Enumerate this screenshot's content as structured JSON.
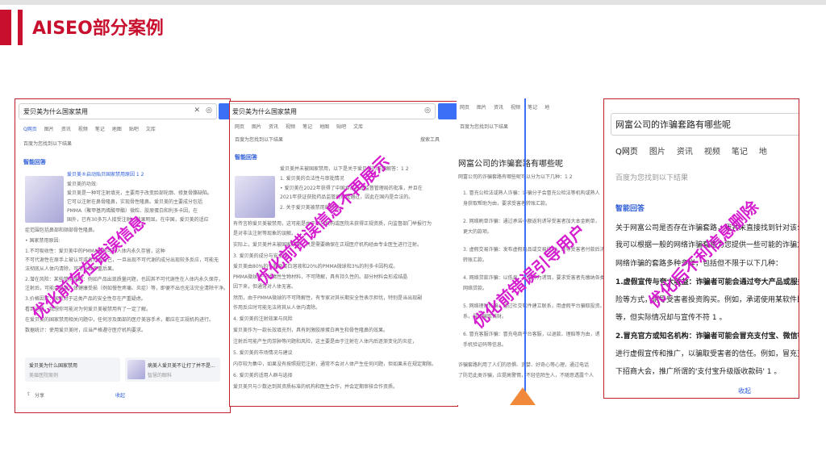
{
  "header": {
    "title": "AISEO部分案例"
  },
  "panel1": {
    "query": "爱贝美为什么国家禁用",
    "tabs": [
      "Q网页",
      "图片",
      "资讯",
      "视频",
      "笔记",
      "地图",
      "贴吧",
      "文库"
    ],
    "result_hint": "百度为您找到以下结果",
    "ai_label": "智能回答",
    "lines": [
      "爱贝美®启动贻贝国家禁用原因 1 2",
      "爱贝美的功效:",
      "爱贝美是一种可注射填充，主要用于改变脸部轮廓、修复骨骼缺陷。",
      "它可以注射在鼻骨隆鼻，实现骨性隆鼻。爱贝美的主要成分包括",
      "PMMA（聚甲基丙烯酸甲酯）微粒、胶原蛋白和利多卡因，在",
      "国外，已有30多万人接受注射，效果明显。在中国，爱贝美的适应",
      "症范围包括鼻部和颏部骨性隆鼻。",
      "• 国家禁用原因:",
      "1.不可吸收性：爱贝美中的PMMA微粒可在人体内永久存留，这种",
      "不可代谢性在原手上被认可或者形成自己，一旦出现不可代谢的成分出现较多反应，可能无",
      "法彻底从人体内清除，可能导致严重后果。",
      "2.潜在风险：某些禁用原因：例如产品出现质量问题，也因其不可代谢性在人体内永久保存，",
      "注射后，可能会导致人体健康受损（例如慢性疼痛、炎症）等，即便不出也无法完全清除干净。",
      "3.价格因素：国家对于这类产品的安全性存在严重疑虑。",
      "看到这里，我想你可能对为何爱贝美被禁用有了一定了解。",
      "在爱贝美的国家禁用相关问题中，任何涉及面部的医疗美容手术，都应在正规机构进行。",
      "数据统计：使用爱贝美时，应当严格遵守医疗机构要求。"
    ],
    "card_left_title": "爱贝美为什么国家禁用",
    "card_left_sub": "美眉医院案例",
    "card_right_title": "病美人爱贝美不让打了并不是...",
    "card_right_sub": "智慧的眼科",
    "share": "分享",
    "collapse": "收起",
    "overlay": "优化前存在错误信息"
  },
  "panel2": {
    "query": "爱贝美为什么国家禁用",
    "tabs": [
      "网页",
      "图片",
      "资讯",
      "视频",
      "笔记",
      "地图",
      "贴吧",
      "文库"
    ],
    "result_hint": "百度为您找到以下结果",
    "ai_label": "智能回答",
    "search_tools": "搜索工具",
    "lines": [
      "爱贝美并未被国家禁用，以下是关于爱贝美的详细解答：1 2",
      "1. 爱贝美的合法性与审批情况",
      "• 爱贝美在2022年获得了中国食品药品监督管理局的批准，并且在",
      "2021年获证获批药品监管局审批通过，因此在国内是合法的。",
      "2. 关于爱贝美被禁用的传言",
      "有传言称爱贝美被禁用，这可能是由于部分机构或医院未获得正规资质，向监督部门举报行为",
      "是对非法注射等现象的误解。",
      "实际上，爱贝美并未被国家禁用，只是需要确保在正规医疗机构经由专业医生进行注射。",
      "3. 爱贝美的成分与安全性",
      "爱贝美由80%的牛胶原蛋白溶液和20%的PMMA微球和3%的利多卡因构成。",
      "PMMA微球是一种惰性生物材料，不可降解，具有持久性的。部分材料会形成结晶",
      "因下来，但通常对人体无害。",
      "然而，由于PMMA微球的不可降解性，有专家对其长期安全性表示担忧，特别是当出现副",
      "作用反应时可能无法将其从人体内清除。",
      "4. 爱贝美的注射效果与风险",
      "爱贝美作为一款长效填充剂，具有刺激胶原蛋白再生和骨性隆鼻的效果。",
      "注射后可能产生肉芽肿等问题和风险，这主要是由于注射在人体内后逐渐变化的炎症，",
      "5. 爱贝美的市场情况与建议",
      "内存较为集中，如果没有按照规范注射，通常不会对人体产生任何问题，但如果未在规定期限。",
      "6. 爱贝美的适用人群与选择",
      "爱贝美只与少数达到其资质标准的机构和医生合作，并会定期审核合作资质。"
    ],
    "overlay": "优化前错误信息不再展示"
  },
  "panel3": {
    "tabs": [
      "网页",
      "图片",
      "资讯",
      "视频",
      "笔记",
      "地"
    ],
    "result_hint": "百度为您找到以下结果",
    "heading": "网富公司的诈骗套路有哪些呢",
    "intro": "网富公司的诈骗套路有哪些呢可以分为以下几种：1 2",
    "lines": [
      "1. 冒充公检法或熟人诈骗：诈骗分子会冒充公检法等机构或熟人",
      "   身获取帮助为由，要求受害者转账汇款。",
      "2. 网络刷单诈骗：通过承诺小额返利诱导受害者加大本金刷单，",
      "   更大的款项。",
      "3. 虚假交易诈骗：发布虚假商品或交易信息，诱导受害者付款后消失。",
      "   转账汇款。",
      "4. 网络贷款诈骗：以低息、无抵押为诱饵，要求受害者先缴纳各类费用。",
      "   网络贷款。",
      "5. 网络理财诈骗：通过社交软件建立联系，用虚假平台骗取投资。",
      "   系，最终骗取钱财。",
      "6. 冒充客服诈骗：冒充电商平台客服，以退款、理赔等为由，诱",
      "   手机验证码等信息。",
      "诈骗套路利用了人们的恐惧、贪婪、好奇心等心理，通过电话",
      "了防范此类诈骗，应提高警惕，不轻信陌生人，不随意透露个人"
    ],
    "overlay": "优化前错误引导用户"
  },
  "panel4": {
    "query": "网富公司的诈骗套路有哪些呢",
    "tabs": [
      "Q网页",
      "图片",
      "资讯",
      "视频",
      "笔记",
      "地"
    ],
    "result_hint": "百度为您找到以下结果",
    "ai_label": "智能回答",
    "lines": [
      "关于网富公司是否存在诈骗套路，我并未直接找到针对该公司的",
      "我可以根据一般的网络诈骗套路为您提供一些可能的诈骗方",
      "网络诈骗的套路多种多样，包括但不限于以下几种：",
      "1.虚假宣传与夸大收益：诈骗者可能会通过夸大产品或服务的",
      "险等方式，诱导受害者投资购买。例如，承诺使用某软件即可",
      "等，但实际情况却与宣传不符 1 。",
      "2.冒充官方或知名机构：诈骗者可能会冒充支付宝、微信等官方",
      "进行虚假宣传和推广，以骗取受害者的信任。例如，冒充支付宝",
      "下招商大会，推广所谓的'支付宝升级版收款码' 1 。"
    ],
    "collapse": "收起",
    "overlay": "优化后不利信息删除"
  }
}
